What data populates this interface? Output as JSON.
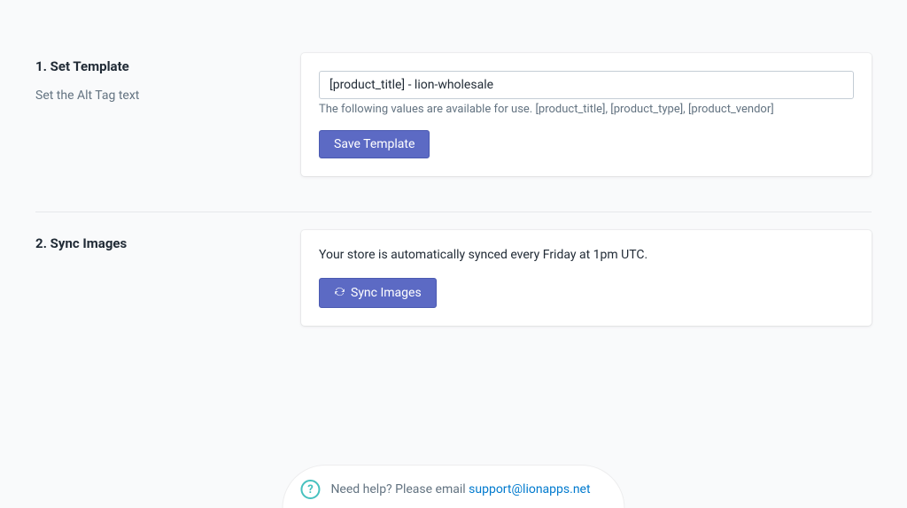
{
  "section1": {
    "heading": "1. Set Template",
    "description": "Set the Alt Tag text",
    "input_value": "[product_title] - lion-wholesale",
    "helper": "The following values are available for use. [product_title], [product_type], [product_vendor]",
    "button_label": "Save Template"
  },
  "section2": {
    "heading": "2. Sync Images",
    "info": "Your store is automatically synced every Friday at 1pm UTC.",
    "button_label": "Sync Images"
  },
  "help": {
    "prefix": "Need help? Please email ",
    "email": "support@lionapps.net"
  }
}
